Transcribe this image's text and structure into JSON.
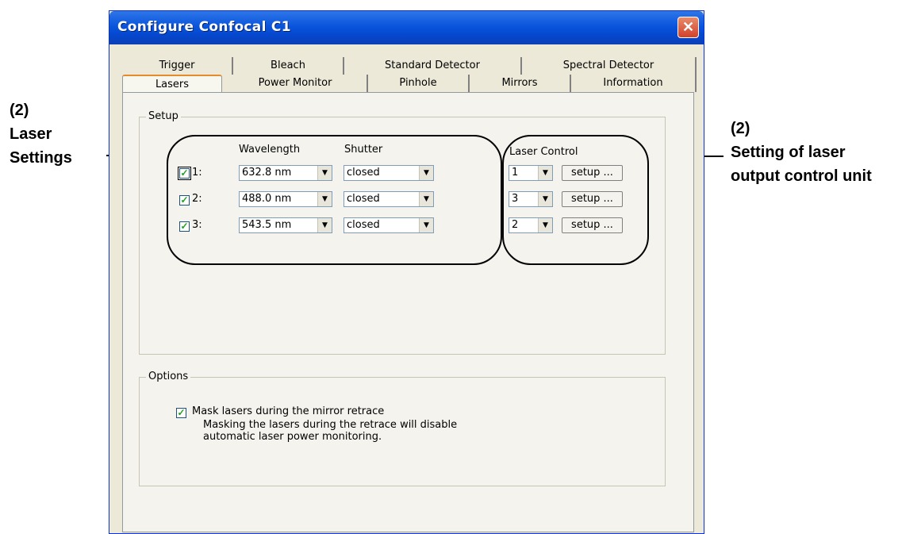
{
  "annotations": {
    "left": {
      "line1": "(2)",
      "line2": "Laser",
      "line3": "Settings"
    },
    "right": {
      "line1": "(2)",
      "line2": "Setting of laser",
      "line3": "output control unit"
    }
  },
  "window": {
    "title": "Configure Confocal C1",
    "close_icon": "close-icon"
  },
  "tabs": {
    "row1": [
      "Trigger",
      "Bleach",
      "Standard Detector",
      "Spectral Detector"
    ],
    "row2": [
      "Lasers",
      "Power Monitor",
      "Pinhole",
      "Mirrors",
      "Information"
    ],
    "selected": "Lasers"
  },
  "setup": {
    "title": "Setup",
    "col_wavelength": "Wavelength",
    "col_shutter": "Shutter",
    "col_laser_control": "Laser Control",
    "lasers": [
      {
        "index": "1:",
        "checked": true,
        "wavelength": "632.8 nm",
        "shutter": "closed",
        "control": "1",
        "setup": "setup ..."
      },
      {
        "index": "2:",
        "checked": true,
        "wavelength": "488.0 nm",
        "shutter": "closed",
        "control": "3",
        "setup": "setup ..."
      },
      {
        "index": "3:",
        "checked": true,
        "wavelength": "543.5 nm",
        "shutter": "closed",
        "control": "2",
        "setup": "setup ..."
      }
    ]
  },
  "options": {
    "title": "Options",
    "mask_checked": true,
    "mask_label": "Mask lasers during the mirror retrace",
    "note_line1": "Masking the lasers during the retrace will disable",
    "note_line2": "automatic laser power monitoring."
  }
}
